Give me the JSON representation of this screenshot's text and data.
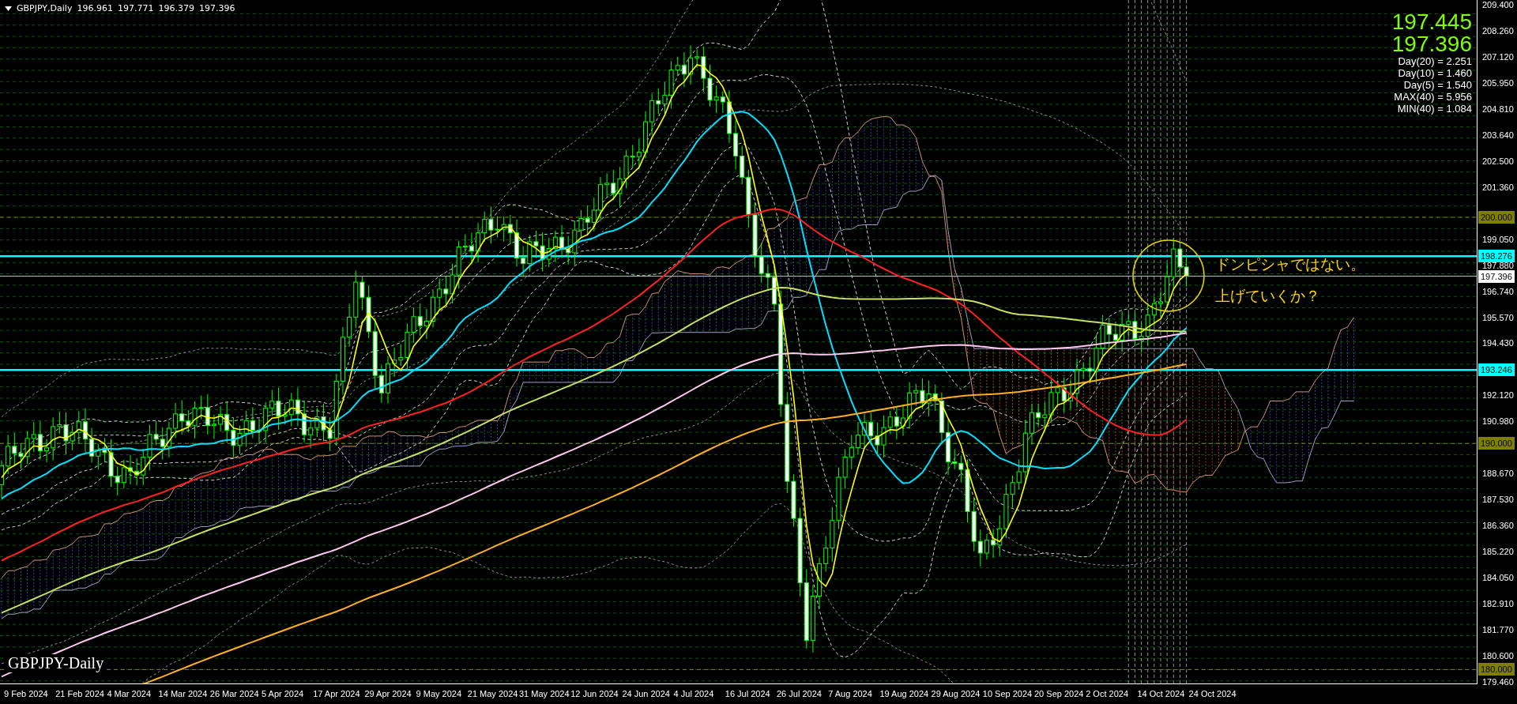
{
  "header": {
    "symbol": "GBPJPY,Daily",
    "ohlc": [
      "196.961",
      "197.771",
      "196.379",
      "197.396"
    ]
  },
  "quotes": [
    "197.445",
    "197.396"
  ],
  "stats": [
    "Day(20) = 2.251",
    "Day(10) = 1.460",
    "Day(5) = 1.540",
    "MAX(40) = 5.956",
    "MIN(40) = 1.084"
  ],
  "annotation": {
    "lines": [
      "ドンピシャではない。",
      "上げていくか？"
    ]
  },
  "chart_label": "GBPJPY-Daily",
  "price_axis": [
    "209.400",
    "208.260",
    "207.120",
    "205.950",
    "204.810",
    "203.640",
    "202.500",
    "201.360",
    "199.050",
    "197.880",
    "196.740",
    "195.570",
    "194.430",
    "192.120",
    "190.980",
    "188.670",
    "187.530",
    "186.360",
    "185.220",
    "184.050",
    "182.910",
    "181.770",
    "180.600",
    "179.460"
  ],
  "price_tags": [
    {
      "label": "200.000",
      "kind": "round"
    },
    {
      "label": "198.276",
      "kind": "line"
    },
    {
      "label": "197.396",
      "kind": "current"
    },
    {
      "label": "193.246",
      "kind": "line"
    },
    {
      "label": "190.000",
      "kind": "round"
    },
    {
      "label": "180.000",
      "kind": "round"
    }
  ],
  "date_axis": [
    "9 Feb 2024",
    "21 Feb 2024",
    "4 Mar 2024",
    "14 Mar 2024",
    "26 Mar 2024",
    "5 Apr 2024",
    "17 Apr 2024",
    "29 Apr 2024",
    "9 May 2024",
    "21 May 2024",
    "31 May 2024",
    "12 Jun 2024",
    "24 Jun 2024",
    "4 Jul 2024",
    "16 Jul 2024",
    "26 Jul 2024",
    "7 Aug 2024",
    "19 Aug 2024",
    "29 Aug 2024",
    "10 Sep 2024",
    "20 Sep 2024",
    "2 Oct 2024",
    "14 Oct 2024",
    "24 Oct 2024"
  ]
}
